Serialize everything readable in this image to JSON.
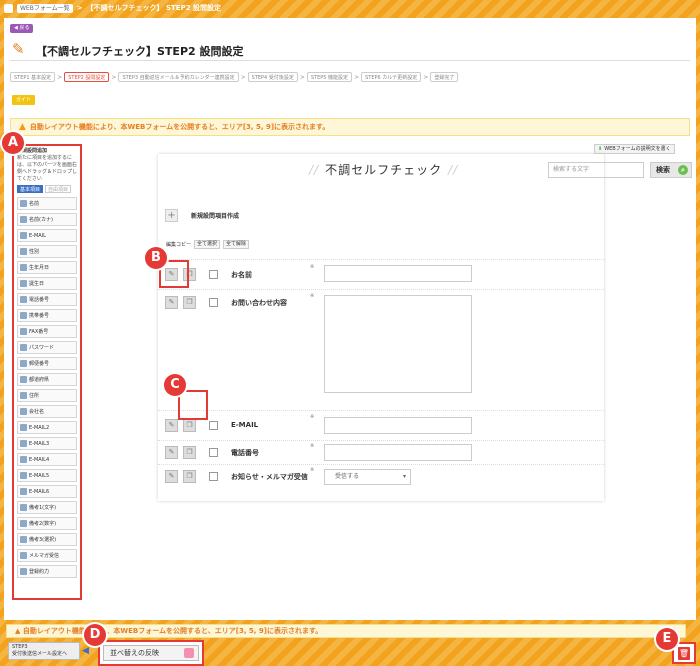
{
  "topbar": {
    "crumb": "WEBフォーム一覧",
    "sep": ">",
    "title": "【不調セルフチェック】 STEP2 設問設定"
  },
  "header": {
    "back_label": "戻る",
    "title": "【不調セルフチェック】STEP2 設問設定"
  },
  "steps": [
    {
      "label": "STEP1 基本設定",
      "current": false
    },
    {
      "label": "STEP2 設問設定",
      "current": true
    },
    {
      "label": "STEP3 自動返信メール＆予約カレンダー連携設定",
      "current": false
    },
    {
      "label": "STEP4 受付後設定",
      "current": false
    },
    {
      "label": "STEP5 機能設定",
      "current": false
    },
    {
      "label": "STEP6 カルテ更新設定",
      "current": false
    },
    {
      "label": "登録完了",
      "current": false
    }
  ],
  "guide_label": "ガイド",
  "notice": "自動レイアウト機能により、本WEBフォームを公開すると、エリア[3, 5, 9]に表示されます。",
  "sidebar": {
    "title": "新規設問追加",
    "desc": "新たに項目を追加するには、以下のパーツを画面右側へドラッグ＆ドロップしてください",
    "tab_basic": "基本項目",
    "tab_custom": "自由項目",
    "parts": [
      "名前",
      "名前(カナ)",
      "E-MAIL",
      "性別",
      "生年月日",
      "誕生日",
      "電話番号",
      "携帯番号",
      "FAX番号",
      "パスワード",
      "郵便番号",
      "都道府県",
      "住所",
      "会社名",
      "E-MAIL2",
      "E-MAIL3",
      "E-MAIL4",
      "E-MAIL5",
      "E-MAIL6",
      "備考1(文字)",
      "備考2(数字)",
      "備考3(選択)",
      "メルマガ受信",
      "登録約力"
    ]
  },
  "badges": {
    "a": "A",
    "b": "B",
    "c": "C",
    "d": "D",
    "e": "E"
  },
  "help_label": "WEBフォームの説明文を書く",
  "form": {
    "title": "不調セルフチェック",
    "search_placeholder": "検索する文字",
    "search_button": "検索",
    "new_question": "新規設問項目作成",
    "tool_edit": "編集",
    "tool_copy": "コピー",
    "select_all": "全て選択",
    "deselect_all": "全て解除",
    "req_mark": "※",
    "questions": [
      "お名前",
      "お問い合わせ内容",
      "E-MAIL",
      "電話番号",
      "お知らせ・メルマガ受信"
    ],
    "select_value": "受信する"
  },
  "footer": {
    "prev_step_l1": "STEP3",
    "prev_step_l2": "受付後送信メール設定へ",
    "reflect_button": "並べ替えの反映",
    "notice": "自動レイアウト機能により、本WEBフォームを公開すると、エリア[3, 5, 9]に表示されます。"
  }
}
